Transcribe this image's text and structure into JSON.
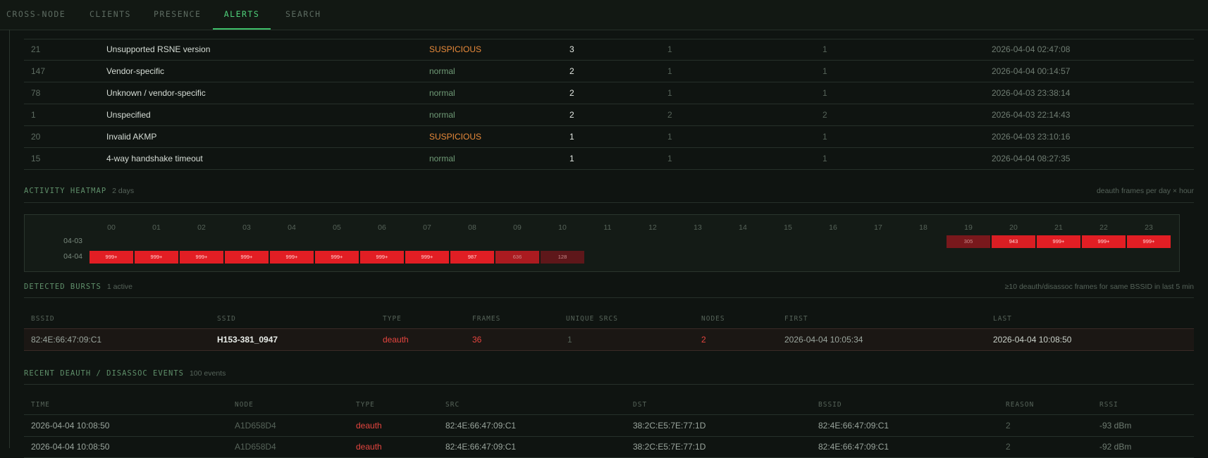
{
  "tabs": [
    {
      "label": "CROSS-NODE",
      "active": false
    },
    {
      "label": "CLIENTS",
      "active": false
    },
    {
      "label": "PRESENCE",
      "active": false
    },
    {
      "label": "ALERTS",
      "active": true
    },
    {
      "label": "SEARCH",
      "active": false
    }
  ],
  "reasons": {
    "rows": [
      {
        "code": "21",
        "reason": "Unsupported RSNE version",
        "class": "SUSPICIOUS",
        "count": "3",
        "nodes": "1",
        "bssids": "1",
        "last": "2026-04-04 02:47:08"
      },
      {
        "code": "147",
        "reason": "Vendor-specific",
        "class": "normal",
        "count": "2",
        "nodes": "1",
        "bssids": "1",
        "last": "2026-04-04 00:14:57"
      },
      {
        "code": "78",
        "reason": "Unknown / vendor-specific",
        "class": "normal",
        "count": "2",
        "nodes": "1",
        "bssids": "1",
        "last": "2026-04-03 23:38:14"
      },
      {
        "code": "1",
        "reason": "Unspecified",
        "class": "normal",
        "count": "2",
        "nodes": "2",
        "bssids": "2",
        "last": "2026-04-03 22:14:43"
      },
      {
        "code": "20",
        "reason": "Invalid AKMP",
        "class": "SUSPICIOUS",
        "count": "1",
        "nodes": "1",
        "bssids": "1",
        "last": "2026-04-03 23:10:16"
      },
      {
        "code": "15",
        "reason": "4-way handshake timeout",
        "class": "normal",
        "count": "1",
        "nodes": "1",
        "bssids": "1",
        "last": "2026-04-04 08:27:35"
      }
    ]
  },
  "heatmap": {
    "title": "ACTIVITY HEATMAP",
    "subtitle": "2 days",
    "right_note": "deauth frames per day × hour",
    "hours": [
      "00",
      "01",
      "02",
      "03",
      "04",
      "05",
      "06",
      "07",
      "08",
      "09",
      "10",
      "11",
      "12",
      "13",
      "14",
      "15",
      "16",
      "17",
      "18",
      "19",
      "20",
      "21",
      "22",
      "23"
    ],
    "days": [
      {
        "label": "04-03",
        "cells": [
          null,
          null,
          null,
          null,
          null,
          null,
          null,
          null,
          null,
          null,
          null,
          null,
          null,
          null,
          null,
          null,
          null,
          null,
          null,
          {
            "text": "305",
            "level": 0.31
          },
          {
            "text": "943",
            "level": 0.94
          },
          {
            "text": "999+",
            "level": 1
          },
          {
            "text": "999+",
            "level": 1
          },
          {
            "text": "999+",
            "level": 1
          }
        ]
      },
      {
        "label": "04-04",
        "cells": [
          {
            "text": "999+",
            "level": 1
          },
          {
            "text": "999+",
            "level": 1
          },
          {
            "text": "999+",
            "level": 1
          },
          {
            "text": "999+",
            "level": 1
          },
          {
            "text": "999+",
            "level": 1
          },
          {
            "text": "999+",
            "level": 1
          },
          {
            "text": "999+",
            "level": 1
          },
          {
            "text": "999+",
            "level": 1
          },
          {
            "text": "987",
            "level": 0.99
          },
          {
            "text": "636",
            "level": 0.64
          },
          {
            "text": "128",
            "level": 0.13
          },
          null,
          null,
          null,
          null,
          null,
          null,
          null,
          null,
          null,
          null,
          null,
          null,
          null
        ]
      }
    ]
  },
  "bursts": {
    "title": "DETECTED BURSTS",
    "subtitle": "1 active",
    "right_note": "≥10 deauth/disassoc frames for same BSSID in last 5 min",
    "headers": [
      "BSSID",
      "SSID",
      "TYPE",
      "FRAMES",
      "UNIQUE SRCS",
      "NODES",
      "FIRST",
      "LAST"
    ],
    "rows": [
      {
        "bssid": "82:4E:66:47:09:C1",
        "ssid": "H153-381_0947",
        "type": "deauth",
        "frames": "36",
        "unique_srcs": "1",
        "nodes": "2",
        "first": "2026-04-04 10:05:34",
        "last": "2026-04-04 10:08:50"
      }
    ]
  },
  "events": {
    "title": "RECENT DEAUTH / DISASSOC EVENTS",
    "subtitle": "100 events",
    "headers": [
      "TIME",
      "NODE",
      "TYPE",
      "SRC",
      "DST",
      "BSSID",
      "REASON",
      "RSSI"
    ],
    "rows": [
      {
        "time": "2026-04-04 10:08:50",
        "node": "A1D658D4",
        "type": "deauth",
        "src": "82:4E:66:47:09:C1",
        "dst": "38:2C:E5:7E:77:1D",
        "bssid": "82:4E:66:47:09:C1",
        "reason": "2",
        "rssi": "-93 dBm"
      },
      {
        "time": "2026-04-04 10:08:50",
        "node": "A1D658D4",
        "type": "deauth",
        "src": "82:4E:66:47:09:C1",
        "dst": "38:2C:E5:7E:77:1D",
        "bssid": "82:4E:66:47:09:C1",
        "reason": "2",
        "rssi": "-92 dBm"
      }
    ]
  },
  "colors": {
    "accent": "#4fd07a",
    "suspicious": "#e98a3a",
    "normal": "#6f9a76",
    "alert_red": "#e5453f",
    "heat_max": "#e0202a"
  }
}
